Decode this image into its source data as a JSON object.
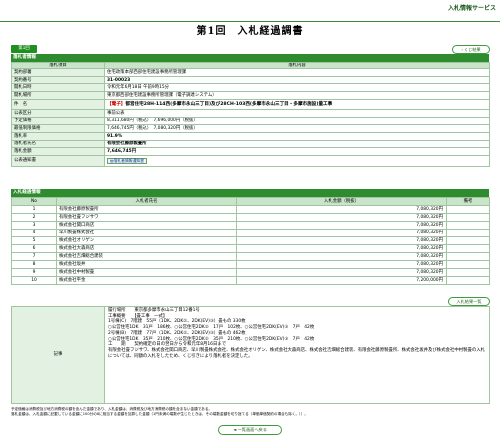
{
  "service_name": "入札情報サービス",
  "page_title": "第1回　入札経過調書",
  "round_tag": "第1回",
  "buttons": {
    "back_to_list": "くじ結果",
    "print_notice": "入札結果一覧",
    "return_list": "◄ 一覧画面へ戻る"
  },
  "section_summary": "落札者情報",
  "summary_header": {
    "item": "落札項目",
    "content": "落札内容"
  },
  "summary": {
    "department": {
      "label": "契約部署",
      "value": "住宅政策本部西部住宅建設事務所管理課"
    },
    "contract_no": {
      "label": "契約番号",
      "value": "31-00023"
    },
    "open_date": {
      "label": "開札日時",
      "value": "令和元年6月18日 午前9時15分"
    },
    "open_place": {
      "label": "開札場所",
      "value": "東京都西部住宅建設事務所管理課（電子調達システム）"
    },
    "subject": {
      "label": "件　名",
      "prefix": "【電子】",
      "value": "都営住宅28H-114西(多摩市永山三丁目)及び28CH-103西(多摩市永山三丁目・多摩市施設)量工事"
    },
    "bid_type": {
      "label": "公表区分",
      "value": "事前公表"
    },
    "planned_price": {
      "label": "予定価格",
      "value": "8,311,680円（税込）　7,696,000円（税抜）"
    },
    "min_price": {
      "label": "最低制限価格",
      "value": "7,646,745円（税込）　7,080,320円（税抜）"
    },
    "rate": {
      "label": "落札率",
      "value": "91.9%"
    },
    "winner": {
      "label": "落札者氏名",
      "value": "有限会社藤原製畳所"
    },
    "amount": {
      "label": "落札金額",
      "value": "7,646,745円"
    },
    "notice": {
      "label": "公表通知書",
      "value": "落札者情報通知書"
    }
  },
  "section_bids": "入札経過情報",
  "bids_header": {
    "no": "No",
    "name": "入札者氏名",
    "amount": "入札金額（税抜）",
    "remark": "備考"
  },
  "bids": [
    {
      "no": "1",
      "name": "有限会社藤原製畳所",
      "amount": "7,080,320円",
      "remark": ""
    },
    {
      "no": "2",
      "name": "有限会社畳フジサワ",
      "amount": "7,080,320円",
      "remark": ""
    },
    {
      "no": "3",
      "name": "株式会社関口商店",
      "amount": "7,080,320円",
      "remark": ""
    },
    {
      "no": "4",
      "name": "早川製畳株式会社",
      "amount": "7,080,320円",
      "remark": ""
    },
    {
      "no": "5",
      "name": "株式会社オリゲン",
      "amount": "7,080,320円",
      "remark": ""
    },
    {
      "no": "6",
      "name": "株式会社大森商店",
      "amount": "7,080,320円",
      "remark": ""
    },
    {
      "no": "7",
      "name": "株式会社吉畑総合建装",
      "amount": "7,080,320円",
      "remark": ""
    },
    {
      "no": "8",
      "name": "株式会社坂井",
      "amount": "7,080,320円",
      "remark": ""
    },
    {
      "no": "9",
      "name": "株式会社中村製畳",
      "amount": "7,080,320円",
      "remark": ""
    },
    {
      "no": "10",
      "name": "株式会社平金",
      "amount": "7,200,000円",
      "remark": ""
    }
  ],
  "remarks_label": "記事",
  "remarks_lines": [
    "履行場所　　東京都多摩市永山三丁目12番1号",
    "工事概要　　【畳工事　一式】",
    "1号棟(C)　7階建　55戸（1DK、2DK②、2DK(EV)③）畳もの 330枚",
    "○公営住宅1DK　31戸　186枚、○公営住宅2DK②　17戸　102枚、○公営住宅2DK(EV)③　7戸　42枚",
    "2号棟(B)　7階建　77戸（1DK、2DK②、2DK(EV)③）畳もの 462枚",
    "○公営住宅1DK　35戸　210枚、○公営住宅2DK②　35戸　210枚、○公営住宅2DK(EV)③　7戸　42枚",
    "工　　期　　契約確定の日の翌日から令和元年8月16日まで",
    "有限会社畳フジサワ、株式会社関口商店、早川製畳株式会社、株式会社オリゲン、株式会社大森商店、株式会社吉畑総合建装、有限会社藤原製畳所、株式会社坂井及び株式会社中村製畳の入札については、同額の入札をしたため、くじ引きにより落札者を決定した。"
  ],
  "notes": [
    "予定価格は消費税及び地方消費税の額を含んだ金額であり、入札金額は、消費税及び地方消費税の額を含まない金額である。",
    "落札金額は、入札金額に記載している金額に100分の8に相当する金額を加算した金額（1円未満の端数が生じたときは、その端数金額を切り捨てる（単価単価契約の場合も除く。））。"
  ]
}
